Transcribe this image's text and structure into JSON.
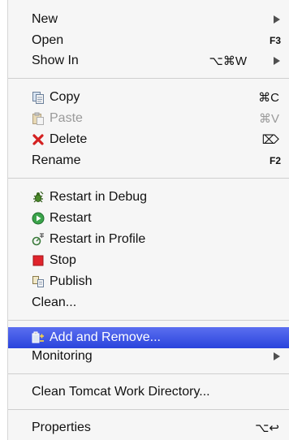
{
  "menu": {
    "group1": {
      "new_label": "New",
      "open_label": "Open",
      "open_shortcut": "F3",
      "show_in_label": "Show In",
      "show_in_shortcut": "⌥⌘W"
    },
    "group2": {
      "copy_label": "Copy",
      "copy_shortcut": "⌘C",
      "paste_label": "Paste",
      "paste_shortcut": "⌘V",
      "delete_label": "Delete",
      "delete_shortcut": "⌦",
      "rename_label": "Rename",
      "rename_shortcut": "F2"
    },
    "group3": {
      "restart_debug_label": "Restart in Debug",
      "restart_label": "Restart",
      "restart_profile_label": "Restart in Profile",
      "stop_label": "Stop",
      "publish_label": "Publish",
      "clean_label": "Clean..."
    },
    "group4": {
      "add_remove_label": "Add and Remove...",
      "monitoring_label": "Monitoring"
    },
    "group5": {
      "clean_tomcat_label": "Clean Tomcat Work Directory..."
    },
    "group6": {
      "properties_label": "Properties",
      "properties_shortcut": "⌥↩"
    }
  },
  "icons": {
    "copy": "copy-icon",
    "paste": "paste-icon",
    "delete": "delete-x-icon",
    "restart_debug": "bug-icon",
    "restart": "green-play-icon",
    "restart_profile": "profile-icon",
    "stop": "red-stop-icon",
    "publish": "publish-icon",
    "add_remove": "add-remove-icon"
  },
  "colors": {
    "selection": "#2a44dc",
    "menu_bg": "#f6f6f6",
    "disabled_text": "#9a9a9a"
  }
}
